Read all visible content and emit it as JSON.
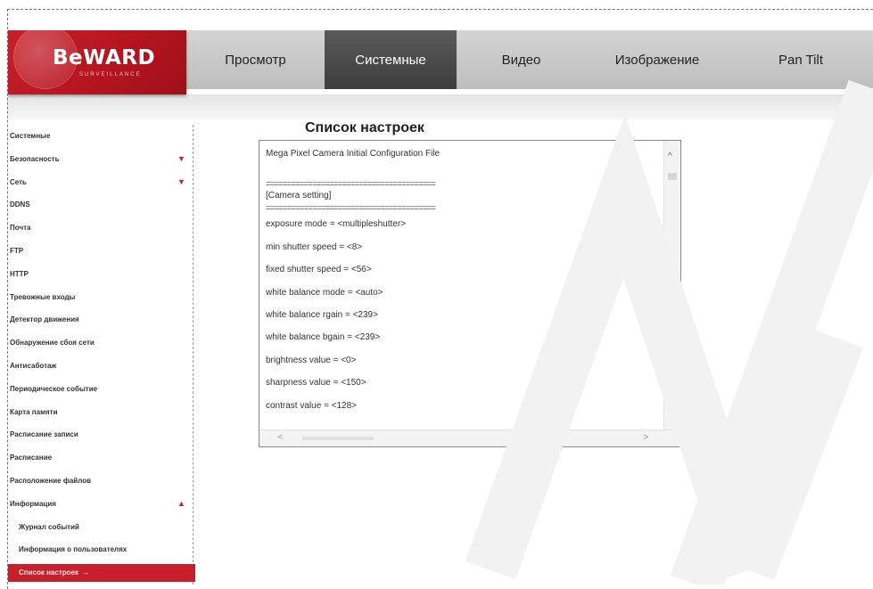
{
  "logo": {
    "text": "BeWARD",
    "sub": "SURVEILLANCE"
  },
  "nav": {
    "tabs": [
      {
        "label": "Просмотр",
        "active": false
      },
      {
        "label": "Системные",
        "active": true
      },
      {
        "label": "Видео",
        "active": false
      },
      {
        "label": "Изображение",
        "active": false
      },
      {
        "label": "Pan Tilt",
        "active": false
      }
    ]
  },
  "sidebar": {
    "items": [
      {
        "label": "Системные",
        "arrow": ""
      },
      {
        "label": "Безопасность",
        "arrow": "▼"
      },
      {
        "label": "Сеть",
        "arrow": "▼"
      },
      {
        "label": "DDNS",
        "arrow": ""
      },
      {
        "label": "Почта",
        "arrow": ""
      },
      {
        "label": "FTP",
        "arrow": ""
      },
      {
        "label": "HTTP",
        "arrow": ""
      },
      {
        "label": "Тревожные входы",
        "arrow": ""
      },
      {
        "label": "Детектор движения",
        "arrow": ""
      },
      {
        "label": "Обнаружение сбоя сети",
        "arrow": ""
      },
      {
        "label": "Антисаботаж",
        "arrow": ""
      },
      {
        "label": "Периодическое событие",
        "arrow": ""
      },
      {
        "label": "Карта памяти",
        "arrow": ""
      },
      {
        "label": "Расписание записи",
        "arrow": ""
      },
      {
        "label": "Расписание",
        "arrow": ""
      },
      {
        "label": "Расположение файлов",
        "arrow": ""
      },
      {
        "label": "Информация",
        "arrow": "▲"
      }
    ],
    "sub_items": [
      {
        "label": "Журнал событий"
      },
      {
        "label": "Информация о пользователях"
      }
    ],
    "selected": {
      "label": "Список настроек",
      "arrow": "→"
    }
  },
  "main": {
    "title": "Список настроек",
    "header_line": "Mega Pixel Camera Initial Configuration File",
    "separator": "========================================",
    "section": "[Camera setting]",
    "settings": [
      "exposure mode = <multipleshutter>",
      "min shutter speed = <8>",
      "fixed shutter speed = <56>",
      "white balance mode = <auto>",
      "white balance rgain = <239>",
      "white balance bgain = <239>",
      "brightness value = <0>",
      "sharpness value = <150>",
      "contrast value = <128>"
    ]
  },
  "icons": {
    "scroll_up": "chevron-up-icon",
    "scroll_down": "chevron-down-icon",
    "scroll_left": "chevron-left-icon",
    "scroll_right": "chevron-right-icon"
  },
  "colors": {
    "brand_red": "#c5202b",
    "active_tab": "#4a4a4a",
    "header_gray": "#c8c8c8"
  }
}
